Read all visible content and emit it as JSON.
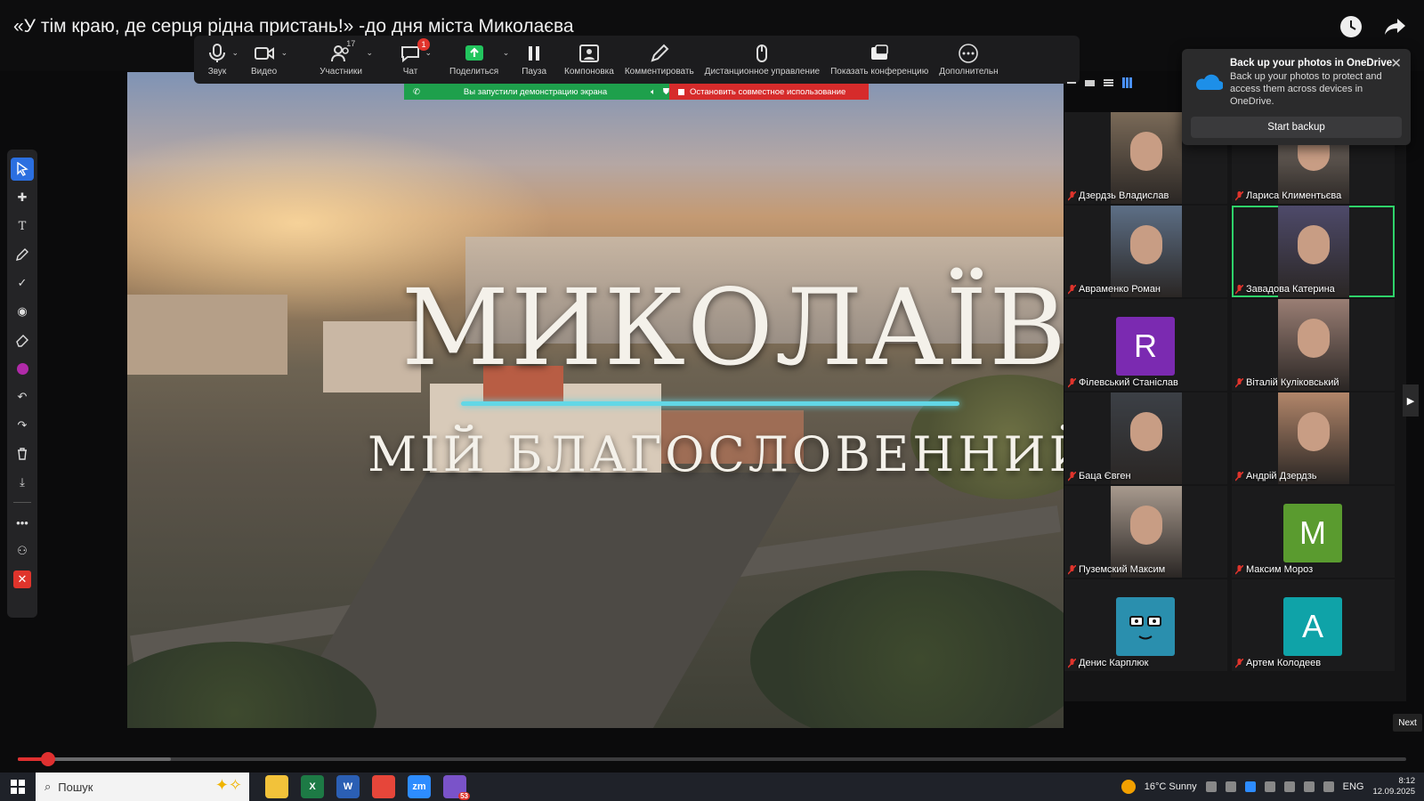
{
  "window": {
    "title": "«У тім краю, де серця рідна пристань!» -до дня міста Миколаєва"
  },
  "toolbar": {
    "items": [
      {
        "label": "Звук",
        "icon": "microphone-icon"
      },
      {
        "label": "Видео",
        "icon": "video-camera-icon"
      },
      {
        "label": "Участники",
        "icon": "participants-icon",
        "count": "17"
      },
      {
        "label": "Чат",
        "icon": "chat-icon",
        "badge": "1"
      },
      {
        "label": "Поделиться",
        "icon": "share-screen-icon"
      },
      {
        "label": "Пауза",
        "icon": "pause-icon"
      },
      {
        "label": "Компоновка",
        "icon": "layout-icon"
      },
      {
        "label": "Комментировать",
        "icon": "annotate-pen-icon"
      },
      {
        "label": "Дистанционное управление",
        "icon": "remote-control-icon"
      },
      {
        "label": "Показать конференцию",
        "icon": "show-meeting-icon"
      },
      {
        "label": "Дополнительн",
        "icon": "more-icon"
      }
    ]
  },
  "share_banner": {
    "status": "Вы запустили демонстрацию экрана",
    "stop_label": "Остановить совместное использование"
  },
  "slide": {
    "title": "МИКОЛАЇВ",
    "subtitle": "МІЙ БЛАГОСЛОВЕННИЙ",
    "accent_color": "#62d7e6"
  },
  "annotation_tools": [
    "select-arrow-icon",
    "move-cross-icon",
    "text-icon",
    "draw-pencil-icon",
    "stamp-check-icon",
    "spotlight-icon",
    "eraser-icon",
    "color-dot-icon",
    "undo-icon",
    "redo-icon",
    "clear-trash-icon",
    "save-download-icon",
    "more-dots-icon",
    "remote-person-icon",
    "close-annotation-icon"
  ],
  "participants": [
    {
      "name": "Дзердзь Владислав",
      "type": "video",
      "color": "#7a6a58"
    },
    {
      "name": "Лариса Климентьєва",
      "type": "video",
      "color": "#8c8076"
    },
    {
      "name": "Авраменко Роман",
      "type": "video",
      "color": "#5d6f86"
    },
    {
      "name": "Завадова Катерина",
      "type": "video",
      "color": "#4e4a6a",
      "speaking": true
    },
    {
      "name": "Філевський Станіслав",
      "type": "letter",
      "letter": "R",
      "color": "#7b2ab1"
    },
    {
      "name": "Віталій Куліковський",
      "type": "video",
      "color": "#9a7e74"
    },
    {
      "name": "Баца Євген",
      "type": "video",
      "color": "#3c4046"
    },
    {
      "name": "Андрій Дзердзь",
      "type": "video",
      "color": "#b2866a"
    },
    {
      "name": "Пуземский Максим",
      "type": "video",
      "color": "#a89a8e"
    },
    {
      "name": "Максим Мороз",
      "type": "letter",
      "letter": "M",
      "color": "#5a9b2f"
    },
    {
      "name": "Денис Карплюк",
      "type": "cartoon",
      "color": "#2a8fae"
    },
    {
      "name": "Артем Колодеев",
      "type": "letter",
      "letter": "A",
      "color": "#0fa3a8"
    }
  ],
  "toast": {
    "title": "Back up your photos in OneDrive",
    "body": "Back up your photos to protect and access them across devices in OneDrive.",
    "button": "Start backup"
  },
  "next_label": "Next",
  "video_progress": {
    "played": 0.022,
    "buffered": 0.11
  },
  "taskbar": {
    "search_placeholder": "Пошук",
    "apps": [
      {
        "name": "file-explorer-icon",
        "label": "",
        "color": "#f2c23a"
      },
      {
        "name": "excel-icon",
        "label": "X",
        "color": "#1d7a45"
      },
      {
        "name": "word-icon",
        "label": "W",
        "color": "#2b5fb4"
      },
      {
        "name": "chrome-icon",
        "label": "",
        "color": "#e6463a"
      },
      {
        "name": "zoom-icon",
        "label": "zm",
        "color": "#2d8cff"
      },
      {
        "name": "viber-icon",
        "label": "",
        "color": "#7a53c9",
        "badge": "53"
      }
    ],
    "weather": "16°C  Sunny",
    "language": "ENG",
    "time": "8:12",
    "date": "12.09.2025"
  }
}
